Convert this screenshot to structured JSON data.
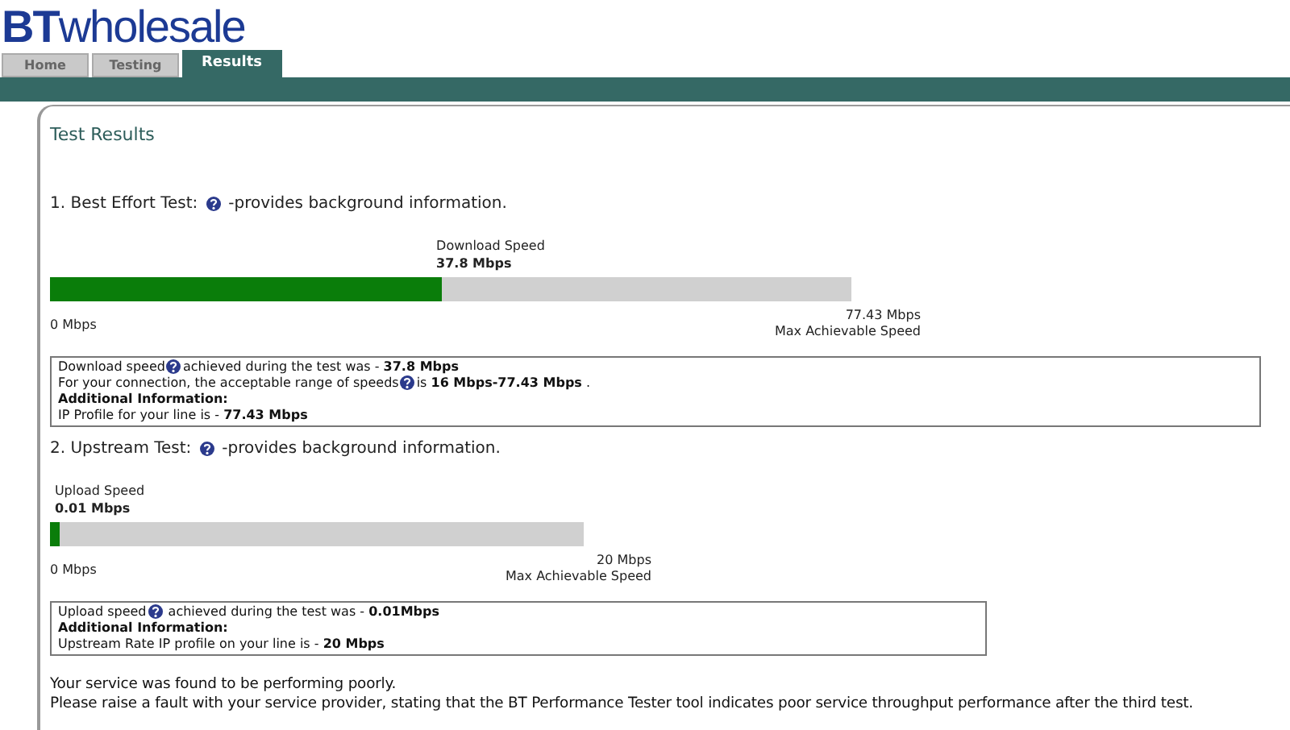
{
  "logo": {
    "brand": "BT",
    "product": "wholesale"
  },
  "tabs": [
    {
      "label": "Home",
      "selected": false
    },
    {
      "label": "Testing",
      "selected": false
    },
    {
      "label": "Results",
      "selected": true
    }
  ],
  "title": "Test Results",
  "tests": [
    {
      "heading": "1. Best Effort Test:",
      "note": "-provides background information.",
      "speed_label": "Download Speed",
      "speed_value": "37.8 Mbps",
      "level": 0.488,
      "min_label": "0 Mbps",
      "max_value": "77.43 Mbps",
      "max_label": "Max Achievable Speed",
      "info_lines": [
        {
          "kind": "help",
          "before": "Download speed",
          "after": "achieved during the test was - **37.8 Mbps**"
        },
        {
          "kind": "help",
          "before": "For your connection, the acceptable range of speeds",
          "after": "is **16 Mbps-77.43 Mbps** ."
        },
        {
          "kind": "heading",
          "text": "Additional Information:"
        },
        {
          "kind": "plain",
          "text": "IP Profile for your line is - **77.43 Mbps**"
        }
      ]
    },
    {
      "heading": "2. Upstream Test:",
      "note": "-provides background information.",
      "speed_label": "Upload Speed",
      "speed_value": "0.01 Mbps",
      "level": 0.018,
      "min_label": "0 Mbps",
      "max_value": "20 Mbps",
      "max_label": "Max Achievable Speed",
      "info_lines": [
        {
          "kind": "help",
          "before": "Upload speed",
          "after": " achieved during the test was - **0.01Mbps**"
        },
        {
          "kind": "heading",
          "text": "Additional Information:"
        },
        {
          "kind": "plain",
          "text": "Upstream Rate IP profile on your line is - **20 Mbps**"
        }
      ]
    }
  ],
  "summary": [
    "Your service was found to be performing poorly.",
    "Please raise a fault with your service provider, stating that the BT Performance Tester tool indicates poor service throughput performance after the third test."
  ]
}
